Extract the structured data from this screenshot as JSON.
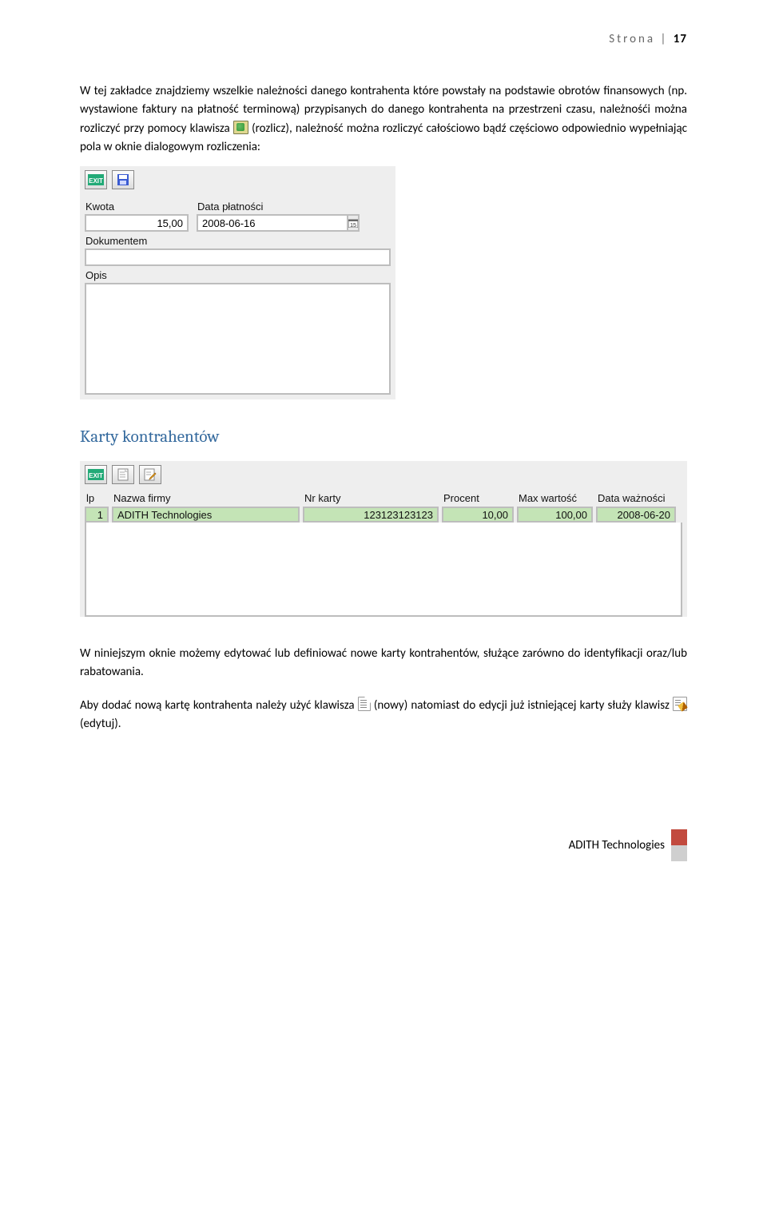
{
  "header": {
    "label": "Strona | ",
    "num": "17"
  },
  "para1_a": "W tej zakładce znajdziemy wszelkie należności danego kontrahenta które powstały na podstawie obrotów finansowych (np. wystawione faktury na płatność terminową) przypisanych do danego kontrahenta na przestrzeni czasu, należnośći można rozliczyć przy pomocy klawisza ",
  "para1_b": " (rozlicz), należność można rozliczyć całościowo bądź częściowo odpowiednio wypełniając pola w oknie dialogowym rozliczenia:",
  "dialog": {
    "kwota_label": "Kwota",
    "kwota_value": "15,00",
    "data_label": "Data płatności",
    "data_value": "2008-06-16",
    "dokumentem_label": "Dokumentem",
    "dokumentem_value": "",
    "opis_label": "Opis",
    "opis_value": ""
  },
  "section_heading": "Karty kontrahentów",
  "grid": {
    "headers": {
      "lp": "lp",
      "nazwa": "Nazwa firmy",
      "nr": "Nr karty",
      "procent": "Procent",
      "max": "Max wartość",
      "data": "Data ważności"
    },
    "row": {
      "lp": "1",
      "nazwa": "ADITH Technologies",
      "nr": "123123123123",
      "procent": "10,00",
      "max": "100,00",
      "data": "2008-06-20"
    }
  },
  "para2": "W niniejszym oknie możemy edytować lub definiować nowe karty kontrahentów, służące zarówno do identyfikacji oraz/lub rabatowania.",
  "para3_a": "Aby dodać nową kartę kontrahenta należy użyć klawisza ",
  "para3_b": " (nowy) natomiast do edycji już istniejącej karty służy klawisz ",
  "para3_c": " (edytuj).",
  "footer": "ADITH Technologies"
}
